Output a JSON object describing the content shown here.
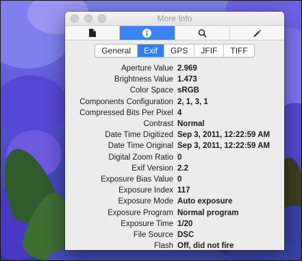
{
  "window": {
    "title": "More Info"
  },
  "toolbar": {
    "tabs": [
      {
        "name": "document-tab",
        "icon": "document-icon",
        "active": false
      },
      {
        "name": "info-tab",
        "icon": "info-icon",
        "active": true
      },
      {
        "name": "search-tab",
        "icon": "magnifier-icon",
        "active": false
      },
      {
        "name": "edit-tab",
        "icon": "pencil-icon",
        "active": false
      }
    ]
  },
  "segments": {
    "items": [
      "General",
      "Exif",
      "GPS",
      "JFIF",
      "TIFF"
    ],
    "selected": "Exif"
  },
  "exif": [
    {
      "key": "Aperture Value",
      "value": "2.969"
    },
    {
      "key": "Brightness Value",
      "value": "1.473"
    },
    {
      "key": "Color Space",
      "value": "sRGB"
    },
    {
      "key": "Components Configuration",
      "value": "2, 1, 3, 1"
    },
    {
      "key": "Compressed Bits Per Pixel",
      "value": "4"
    },
    {
      "key": "Contrast",
      "value": "Normal"
    },
    {
      "key": "Date Time Digitized",
      "value": "Sep 3, 2011, 12:22:59 AM"
    },
    {
      "key": "Date Time Original",
      "value": "Sep 3, 2011, 12:22:59 AM"
    },
    {
      "key": "Digital Zoom Ratio",
      "value": "0"
    },
    {
      "key": "Exif Version",
      "value": "2.2"
    },
    {
      "key": "Exposure Bias Value",
      "value": "0"
    },
    {
      "key": "Exposure Index",
      "value": "117"
    },
    {
      "key": "Exposure Mode",
      "value": "Auto exposure"
    },
    {
      "key": "Exposure Program",
      "value": "Normal program"
    },
    {
      "key": "Exposure Time",
      "value": "1/20"
    },
    {
      "key": "File Source",
      "value": "DSC"
    },
    {
      "key": "Flash",
      "value": "Off, did not fire"
    }
  ],
  "colors": {
    "accent": "#2e7ef6",
    "toolbar_active": "#3b82f6",
    "window_bg": "#ececec"
  }
}
